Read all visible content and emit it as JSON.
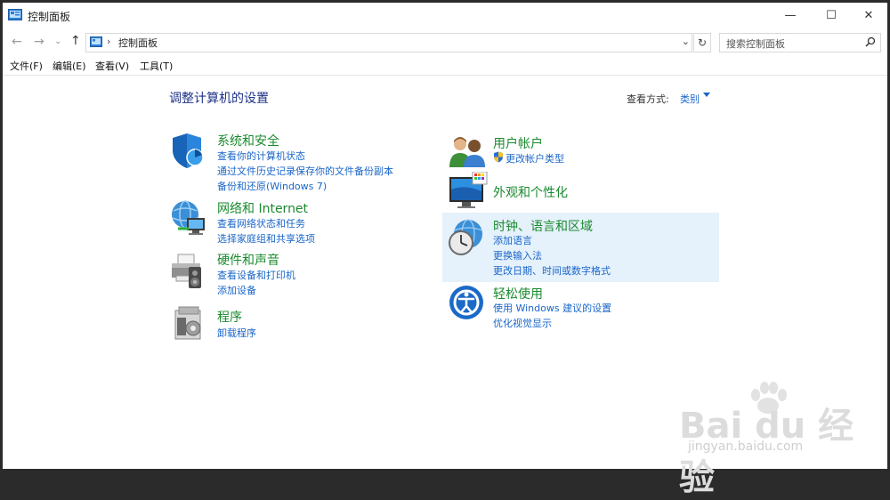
{
  "window": {
    "title": "控制面板",
    "minimize": "—",
    "maximize": "☐",
    "close": "✕"
  },
  "address": {
    "back": "←",
    "forward": "→",
    "recent": "⌄",
    "up": "↑",
    "separator": "›",
    "path": "控制面板",
    "dropdown": "⌄",
    "refresh": "↻",
    "search_placeholder": "搜索控制面板"
  },
  "menu": [
    "文件(F)",
    "编辑(E)",
    "查看(V)",
    "工具(T)"
  ],
  "main": {
    "heading": "调整计算机的设置",
    "view_by_label": "查看方式:",
    "view_by_value": "类别"
  },
  "categories_left": [
    {
      "title": "系统和安全",
      "links": [
        "查看你的计算机状态",
        "通过文件历史记录保存你的文件备份副本",
        "备份和还原(Windows 7)"
      ],
      "icon": "shield-icon"
    },
    {
      "title": "网络和 Internet",
      "links": [
        "查看网络状态和任务",
        "选择家庭组和共享选项"
      ],
      "icon": "network-globe-icon"
    },
    {
      "title": "硬件和声音",
      "links": [
        "查看设备和打印机",
        "添加设备"
      ],
      "icon": "printer-speaker-icon"
    },
    {
      "title": "程序",
      "links": [
        "卸载程序"
      ],
      "icon": "programs-icon"
    }
  ],
  "categories_right": [
    {
      "title": "用户帐户",
      "links": [
        "更改帐户类型"
      ],
      "icon": "users-icon"
    },
    {
      "title": "外观和个性化",
      "links": [],
      "icon": "monitor-palette-icon"
    },
    {
      "title": "时钟、语言和区域",
      "links": [
        "添加语言",
        "更换输入法",
        "更改日期、时间或数字格式"
      ],
      "icon": "clock-globe-icon"
    },
    {
      "title": "轻松使用",
      "links": [
        "使用 Windows 建议的设置",
        "优化视觉显示"
      ],
      "icon": "ease-of-access-icon"
    }
  ],
  "watermark": {
    "text": "Bai du 经验",
    "sub": "jingyan.baidu.com"
  },
  "colors": {
    "accent": "#1a66c8",
    "category_title": "#1a8a2e",
    "heading": "#1e3287",
    "highlight": "#e5f1fb"
  }
}
